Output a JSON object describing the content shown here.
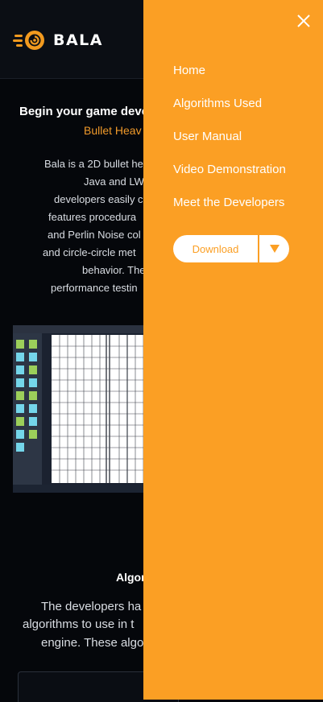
{
  "brand": {
    "name": "BALA"
  },
  "hero": {
    "title": "Begin your game devel",
    "subtitle": "Bullet Heav"
  },
  "description": {
    "lines": [
      "Bala is a 2D bullet he",
      "Java and LWJGL",
      "developers easily c",
      "features procedura",
      "and Perlin Noise col",
      "and circle-circle met",
      "behavior. The eng",
      "performance testin"
    ]
  },
  "algorithms": {
    "title": "Algor",
    "lines": [
      "The developers ha",
      "algorithms to use in t",
      "engine. These algo"
    ]
  },
  "drawer": {
    "close_icon": "close-icon",
    "nav": [
      {
        "label": "Home"
      },
      {
        "label": "Algorithms Used"
      },
      {
        "label": "User Manual"
      },
      {
        "label": "Video Demonstration"
      },
      {
        "label": "Meet the Developers"
      }
    ],
    "download": {
      "label": "Download",
      "icon": "caret-down-icon"
    }
  },
  "colors": {
    "accent": "#fb9f24",
    "background": "#05070b",
    "subtitle": "#f19a2a"
  }
}
